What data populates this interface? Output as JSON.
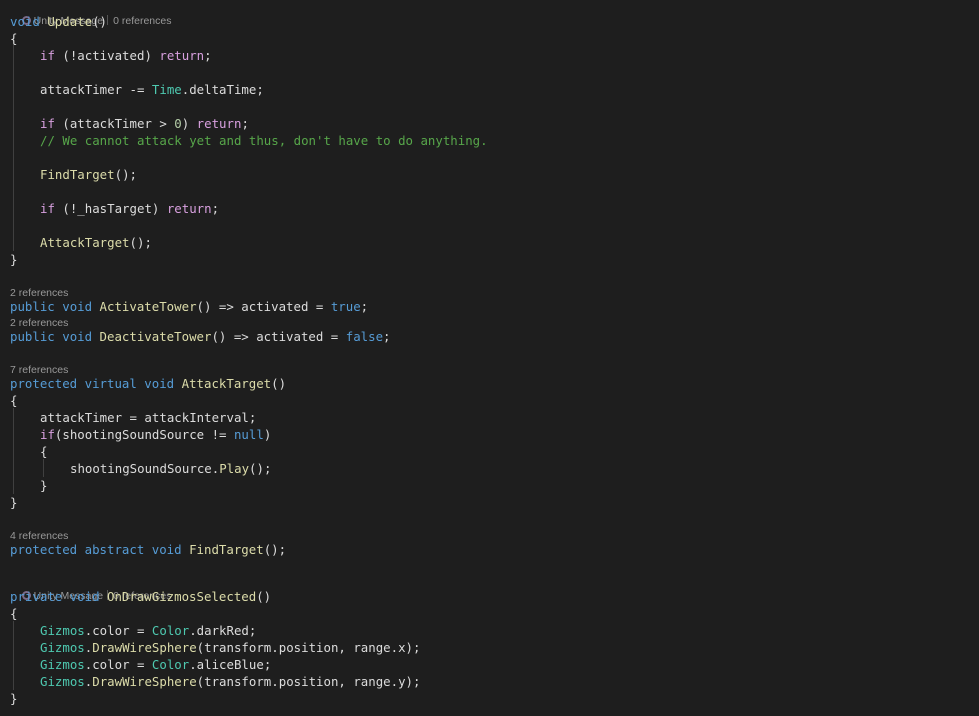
{
  "colors": {
    "background": "#1e1e1e",
    "keyword": "#569cd6",
    "control_keyword": "#d8a0df",
    "type": "#4ec9b0",
    "method": "#dcdcaa",
    "comment": "#57a64a",
    "number": "#b5cea8",
    "identifier": "#dcdcdc",
    "codelens": "#999999"
  },
  "codelens": {
    "update": {
      "icon": "unity-icon",
      "message": "Unity Message",
      "references": "0 references"
    },
    "activate_tower": {
      "references": "2 references"
    },
    "deactivate_tower": {
      "references": "2 references"
    },
    "attack_target": {
      "references": "7 references"
    },
    "find_target": {
      "references": "4 references"
    },
    "on_draw_gizmos": {
      "icon": "unity-icon",
      "message": "Unity Message",
      "references": "0 references"
    }
  },
  "code": [
    {
      "t": "void",
      "c": "kw"
    },
    {
      "t": " ",
      "c": "pl"
    },
    {
      "t": "Update",
      "c": "meth"
    },
    {
      "t": "()",
      "c": "pl"
    },
    {
      "t": "{",
      "c": "pl"
    },
    {
      "t": "if",
      "c": "ctl"
    },
    {
      "t": " (!activated) ",
      "c": "pl"
    },
    {
      "t": "return",
      "c": "ctl"
    },
    {
      "t": ";",
      "c": "pl"
    },
    {
      "t": "attackTimer -= ",
      "c": "pl"
    },
    {
      "t": "Time",
      "c": "type"
    },
    {
      "t": ".deltaTime;",
      "c": "pl"
    },
    {
      "t": "if",
      "c": "ctl"
    },
    {
      "t": " (attackTimer > ",
      "c": "pl"
    },
    {
      "t": "0",
      "c": "num"
    },
    {
      "t": ") ",
      "c": "pl"
    },
    {
      "t": "return",
      "c": "ctl"
    },
    {
      "t": ";",
      "c": "pl"
    },
    {
      "t": "// We cannot attack yet and thus, don't have to do anything.",
      "c": "cm"
    },
    {
      "t": "FindTarget",
      "c": "meth"
    },
    {
      "t": "();",
      "c": "pl"
    },
    {
      "t": "if",
      "c": "ctl"
    },
    {
      "t": " (!_hasTarget) ",
      "c": "pl"
    },
    {
      "t": "return",
      "c": "ctl"
    },
    {
      "t": ";",
      "c": "pl"
    },
    {
      "t": "AttackTarget",
      "c": "meth"
    },
    {
      "t": "();",
      "c": "pl"
    },
    {
      "t": "}",
      "c": "pl"
    },
    {
      "t": "public",
      "c": "kw"
    },
    {
      "t": " ",
      "c": "pl"
    },
    {
      "t": "void",
      "c": "kw"
    },
    {
      "t": " ",
      "c": "pl"
    },
    {
      "t": "ActivateTower",
      "c": "meth"
    },
    {
      "t": "() => activated = ",
      "c": "pl"
    },
    {
      "t": "true",
      "c": "kw"
    },
    {
      "t": ";",
      "c": "pl"
    },
    {
      "t": "public",
      "c": "kw"
    },
    {
      "t": " ",
      "c": "pl"
    },
    {
      "t": "void",
      "c": "kw"
    },
    {
      "t": " ",
      "c": "pl"
    },
    {
      "t": "DeactivateTower",
      "c": "meth"
    },
    {
      "t": "() => activated = ",
      "c": "pl"
    },
    {
      "t": "false",
      "c": "kw"
    },
    {
      "t": ";",
      "c": "pl"
    },
    {
      "t": "protected",
      "c": "kw"
    },
    {
      "t": " ",
      "c": "pl"
    },
    {
      "t": "virtual",
      "c": "kw"
    },
    {
      "t": " ",
      "c": "pl"
    },
    {
      "t": "void",
      "c": "kw"
    },
    {
      "t": " ",
      "c": "pl"
    },
    {
      "t": "AttackTarget",
      "c": "meth"
    },
    {
      "t": "()",
      "c": "pl"
    },
    {
      "t": "{",
      "c": "pl"
    },
    {
      "t": "attackTimer = attackInterval;",
      "c": "pl"
    },
    {
      "t": "if",
      "c": "ctl"
    },
    {
      "t": "(shootingSoundSource != ",
      "c": "pl"
    },
    {
      "t": "null",
      "c": "kw"
    },
    {
      "t": ")",
      "c": "pl"
    },
    {
      "t": "{",
      "c": "pl"
    },
    {
      "t": "shootingSoundSource.",
      "c": "pl"
    },
    {
      "t": "Play",
      "c": "meth"
    },
    {
      "t": "();",
      "c": "pl"
    },
    {
      "t": "}",
      "c": "pl"
    },
    {
      "t": "}",
      "c": "pl"
    },
    {
      "t": "protected",
      "c": "kw"
    },
    {
      "t": " ",
      "c": "pl"
    },
    {
      "t": "abstract",
      "c": "kw"
    },
    {
      "t": " ",
      "c": "pl"
    },
    {
      "t": "void",
      "c": "kw"
    },
    {
      "t": " ",
      "c": "pl"
    },
    {
      "t": "FindTarget",
      "c": "meth"
    },
    {
      "t": "();",
      "c": "pl"
    },
    {
      "t": "private",
      "c": "kw"
    },
    {
      "t": " ",
      "c": "pl"
    },
    {
      "t": "void",
      "c": "kw"
    },
    {
      "t": " ",
      "c": "pl"
    },
    {
      "t": "OnDrawGizmosSelected",
      "c": "meth"
    },
    {
      "t": "()",
      "c": "pl"
    },
    {
      "t": "{",
      "c": "pl"
    },
    {
      "t": "Gizmos",
      "c": "type"
    },
    {
      "t": ".color = ",
      "c": "pl"
    },
    {
      "t": "Color",
      "c": "type"
    },
    {
      "t": ".darkRed;",
      "c": "pl"
    },
    {
      "t": "Gizmos",
      "c": "type"
    },
    {
      "t": ".",
      "c": "pl"
    },
    {
      "t": "DrawWireSphere",
      "c": "meth"
    },
    {
      "t": "(transform.position, range.x);",
      "c": "pl"
    },
    {
      "t": "Gizmos",
      "c": "type"
    },
    {
      "t": ".color = ",
      "c": "pl"
    },
    {
      "t": "Color",
      "c": "type"
    },
    {
      "t": ".aliceBlue;",
      "c": "pl"
    },
    {
      "t": "Gizmos",
      "c": "type"
    },
    {
      "t": ".",
      "c": "pl"
    },
    {
      "t": "DrawWireSphere",
      "c": "meth"
    },
    {
      "t": "(transform.position, range.y);",
      "c": "pl"
    },
    {
      "t": "}",
      "c": "pl"
    }
  ]
}
